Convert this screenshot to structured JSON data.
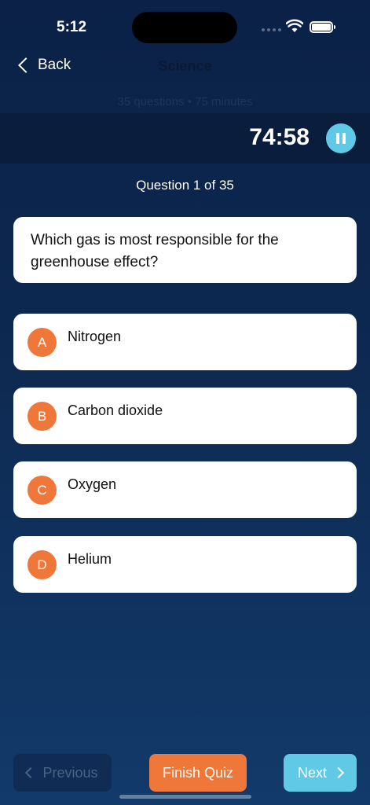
{
  "status_bar": {
    "time": "5:12"
  },
  "nav": {
    "back_label": "Back",
    "title": "Science",
    "subtitle": "35 questions • 75 minutes"
  },
  "timer": {
    "value": "74:58"
  },
  "progress": {
    "label": "Question 1 of 35"
  },
  "question": {
    "text": "Which gas is most responsible for the greenhouse effect?"
  },
  "options": [
    {
      "letter": "A",
      "text": "Nitrogen"
    },
    {
      "letter": "B",
      "text": "Carbon dioxide"
    },
    {
      "letter": "C",
      "text": "Oxygen"
    },
    {
      "letter": "D",
      "text": "Helium"
    }
  ],
  "footer": {
    "previous_label": "Previous",
    "finish_label": "Finish Quiz",
    "next_label": "Next"
  },
  "colors": {
    "accent_orange": "#f0773a",
    "accent_cyan": "#5fc9e6",
    "background": "#0d2850"
  }
}
